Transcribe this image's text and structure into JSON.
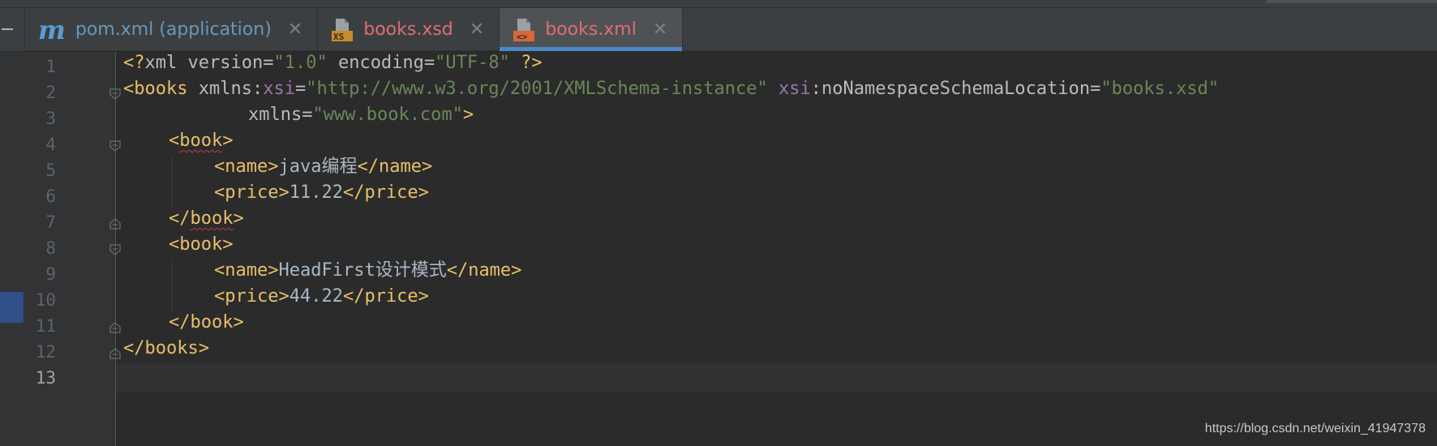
{
  "tabs": [
    {
      "label": "pom.xml (application)",
      "icon": "maven-m-icon",
      "color": "#6897bb",
      "active": false
    },
    {
      "label": "books.xsd",
      "icon": "xsd-file-icon",
      "color": "#e06c75",
      "active": false
    },
    {
      "label": "books.xml",
      "icon": "xml-file-icon",
      "color": "#e06c75",
      "active": true
    }
  ],
  "tab_close_glyph": "✕",
  "icon_m_glyph": "m",
  "xsd_badge": "XS",
  "xml_badge": "<>",
  "line_numbers": [
    "1",
    "2",
    "3",
    "4",
    "5",
    "6",
    "7",
    "8",
    "9",
    "10",
    "11",
    "12",
    "13"
  ],
  "current_line": 13,
  "code": {
    "l1": {
      "pi_open": "<?",
      "xml": "xml",
      "sp1": " ",
      "version_attr": "version",
      "eq1": "=",
      "version_val": "\"1.0\"",
      "sp2": " ",
      "encoding_attr": "encoding",
      "eq2": "=",
      "encoding_val": "\"UTF-8\"",
      "sp3": " ",
      "pi_close": "?>"
    },
    "l2": {
      "open": "<books",
      "sp1": " ",
      "xmlns": "xmlns",
      "colon1": ":",
      "xsi": "xsi",
      "eq1": "=",
      "xsi_val": "\"http://www.w3.org/2001/XMLSchema-instance\"",
      "sp2": " ",
      "xsi2": "xsi",
      "colon2": ":",
      "nsl": "noNamespaceSchemaLocation",
      "eq2": "=",
      "nsl_val": "\"books.xsd\""
    },
    "l3": {
      "xmlns": "xmlns",
      "eq": "=",
      "val": "\"www.book.com\"",
      "close": ">"
    },
    "l4": {
      "lt": "<",
      "name": "book",
      "gt": ">"
    },
    "l5": {
      "open": "<name>",
      "text": "java编程",
      "close": "</name>"
    },
    "l6": {
      "open": "<price>",
      "text": "11.22",
      "close": "</price>"
    },
    "l7": {
      "lt": "</",
      "name": "book",
      "gt": ">"
    },
    "l8": {
      "open": "<book>"
    },
    "l9": {
      "open": "<name>",
      "text": "HeadFirst设计模式",
      "close": "</name>"
    },
    "l10": {
      "open": "<price>",
      "text": "44.22",
      "close": "</price>"
    },
    "l11": {
      "close": "</book>"
    },
    "l12": {
      "close": "</books>"
    }
  },
  "watermark": "https://blog.csdn.net/weixin_41947378",
  "colors": {
    "background": "#2b2b2b",
    "tag": "#e8bf6a",
    "attribute": "#bababa",
    "namespace": "#9876aa",
    "string": "#6a8759",
    "text": "#a9b7c6",
    "active_tab_underline": "#4a88c7"
  }
}
